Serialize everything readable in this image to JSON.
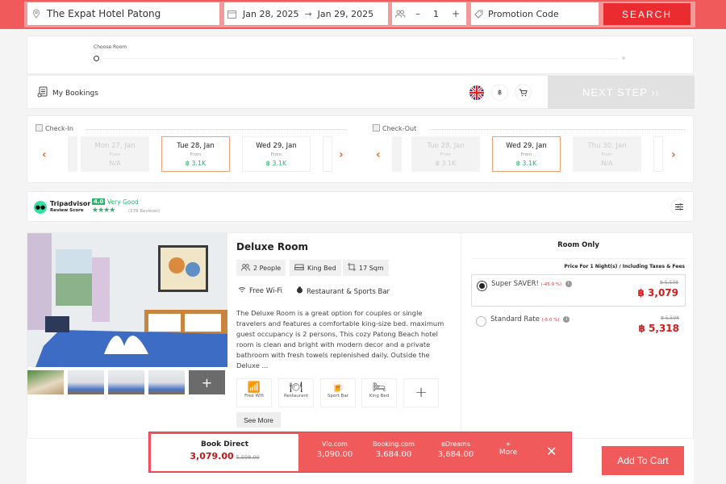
{
  "search": {
    "location": "The Expat Hotel Patong",
    "checkin": "Jan 28, 2025",
    "arrow": "→",
    "checkout": "Jan 29, 2025",
    "guests_minus": "–",
    "guests": "1",
    "guests_plus": "+",
    "promo_placeholder": "Promotion Code",
    "search_label": "SEARCH"
  },
  "steps": {
    "current": "Choose Room"
  },
  "nav": {
    "my_bookings": "My Bookings",
    "currency": "฿",
    "next_step": "NEXT STEP ››"
  },
  "checkin": {
    "title": "Check-In",
    "days": [
      {
        "day": "Mon 27, Jan",
        "from": "From",
        "price": "N/A",
        "state": "disabled"
      },
      {
        "day": "Tue 28, Jan",
        "from": "From",
        "price": "฿ 3.1K",
        "state": "selected"
      },
      {
        "day": "Wed 29, Jan",
        "from": "From",
        "price": "฿ 3.1K",
        "state": "available"
      }
    ]
  },
  "checkout": {
    "title": "Check-Out",
    "days": [
      {
        "day": "Tue 28, Jan",
        "from": "From",
        "price": "฿ 3.1K",
        "state": "disabled"
      },
      {
        "day": "Wed 29, Jan",
        "from": "From",
        "price": "฿ 3.1K",
        "state": "selected"
      },
      {
        "day": "Thu 30, Jan",
        "from": "From",
        "price": "N/A",
        "state": "disabled"
      }
    ]
  },
  "review": {
    "brand": "Tripadvisor",
    "sub": "Review Score",
    "score": "4.0",
    "rating_text": "Very Good",
    "stars": "★★★★",
    "count": "(278 Reviews)"
  },
  "room": {
    "name": "Deluxe Room",
    "chips": [
      "2 People",
      "King Bed",
      "17 Sqm"
    ],
    "amenities": [
      "Free Wi-Fi",
      "Restaurant & Sports Bar"
    ],
    "description": "The Deluxe Room is a great option for couples or single travelers and features a comfortable king-size bed. maximum guest occupancy is 2 persons, This cozy Patong Beach hotel room is clean and bright with modern decor and a private bathroom with fresh towels replenished daily. Outside the Deluxe ...",
    "facilities": [
      "Free Wifi",
      "Restaurant",
      "Sport Bar",
      "King Bed"
    ],
    "more_symbol": "+",
    "see_more": "See More"
  },
  "rates": {
    "title": "Room Only",
    "note": "Price For 1 Night(s) / Including Taxes & Fees",
    "options": [
      {
        "name": "Super SAVER!",
        "discount": "(-45.0 %)",
        "old": "฿ 5,598",
        "price": "฿ 3,079",
        "selected": true
      },
      {
        "name": "Standard Rate",
        "discount": "(-5.0 %)",
        "old": "฿ 5,598",
        "price": "฿ 5,318",
        "selected": false
      }
    ]
  },
  "compare": {
    "direct_label": "Book Direct",
    "direct_price": "3,079.00",
    "direct_old": "5,598.00",
    "otas": [
      {
        "name": "Vio.com",
        "price": "3,090.00"
      },
      {
        "name": "Booking.com",
        "price": "3,684.00"
      },
      {
        "name": "eDreams",
        "price": "3,684.00"
      }
    ],
    "more_plus": "+",
    "more_label": "More",
    "close": "✕"
  },
  "cart": {
    "add_label": "Add To Cart"
  },
  "colors": {
    "brand": "#f05a5b",
    "search": "#ea2b2f",
    "price": "#d41a1a",
    "green": "#2cb46c",
    "accent": "#e86a2b"
  }
}
